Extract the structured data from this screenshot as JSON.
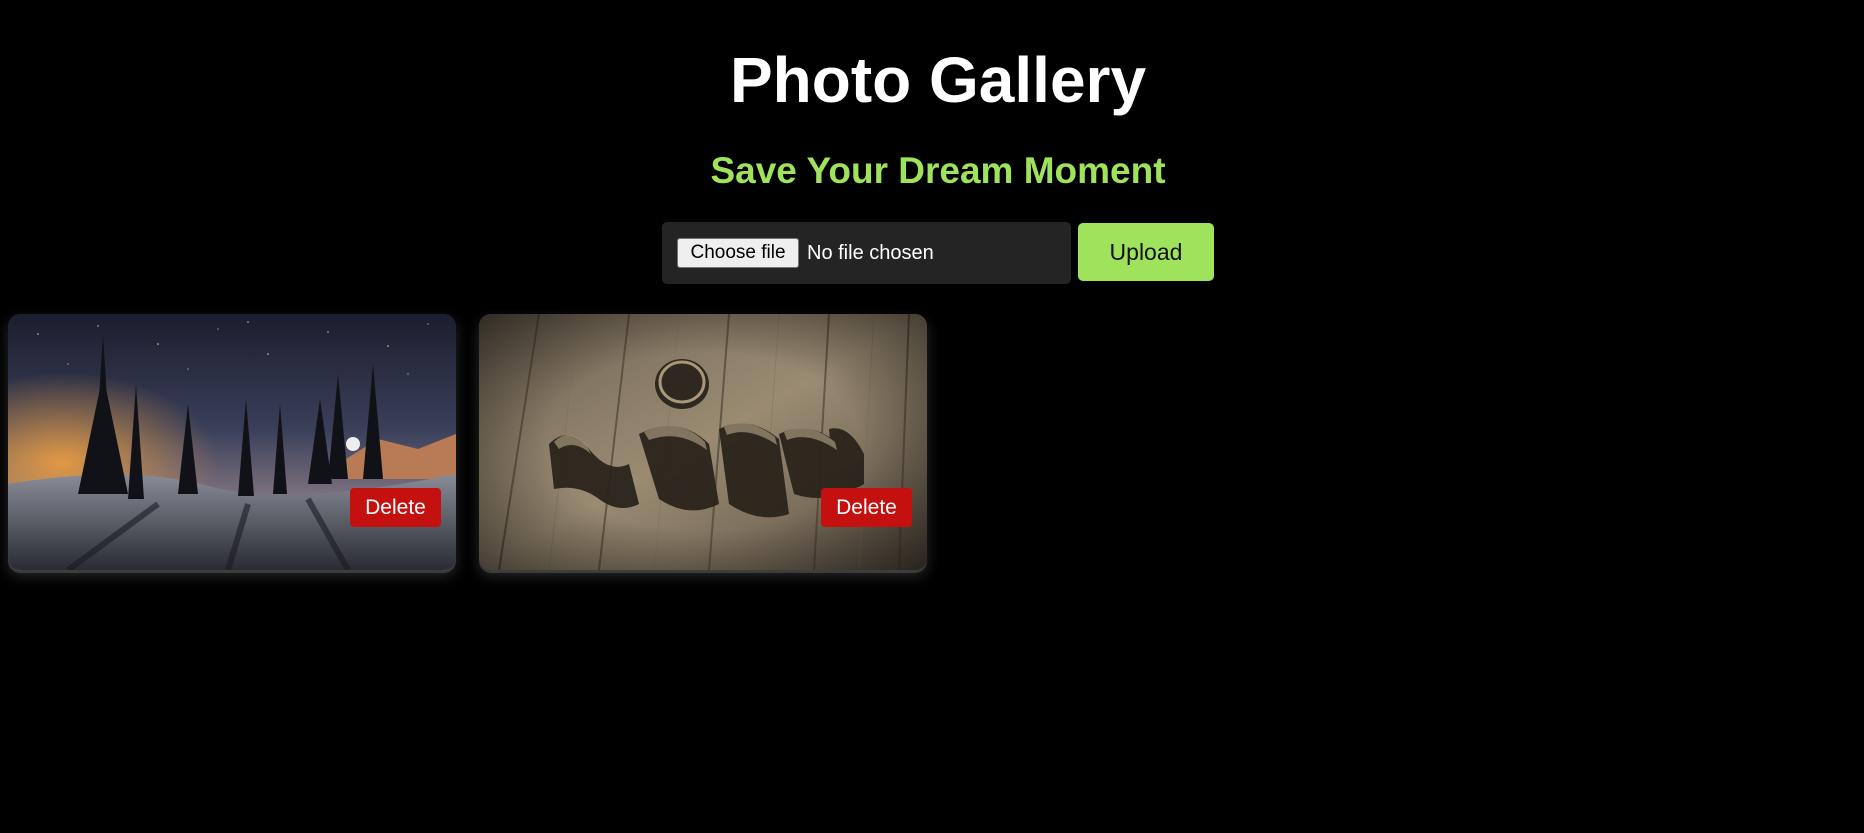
{
  "header": {
    "title": "Photo Gallery",
    "subtitle": "Save Your Dream Moment"
  },
  "upload": {
    "choose_label": "Choose file",
    "file_status": "No file chosen",
    "upload_label": "Upload"
  },
  "gallery": {
    "items": [
      {
        "delete_label": "Delete"
      },
      {
        "delete_label": "Delete"
      }
    ]
  },
  "colors": {
    "background": "#000000",
    "accent": "#9fe25c",
    "delete": "#c4110f"
  }
}
